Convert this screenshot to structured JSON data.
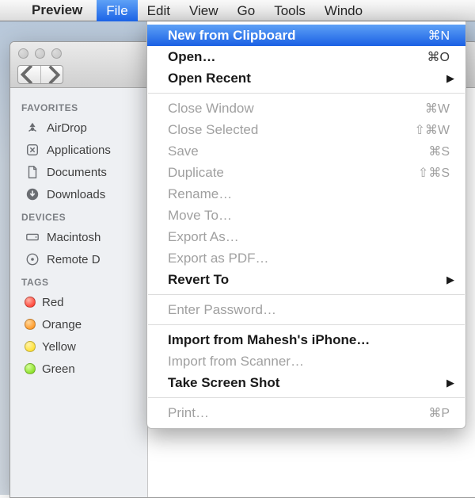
{
  "menubar": {
    "app_name": "Preview",
    "items": [
      "File",
      "Edit",
      "View",
      "Go",
      "Tools",
      "Windo"
    ]
  },
  "file_menu": {
    "groups": [
      [
        {
          "label": "New from Clipboard",
          "shortcut": "⌘N",
          "selected": true,
          "bold": true
        },
        {
          "label": "Open…",
          "shortcut": "⌘O",
          "bold": true
        },
        {
          "label": "Open Recent",
          "submenu": true,
          "bold": true
        }
      ],
      [
        {
          "label": "Close Window",
          "shortcut": "⌘W",
          "disabled": true
        },
        {
          "label": "Close Selected",
          "shortcut": "⇧⌘W",
          "disabled": true
        },
        {
          "label": "Save",
          "shortcut": "⌘S",
          "disabled": true
        },
        {
          "label": "Duplicate",
          "shortcut": "⇧⌘S",
          "disabled": true
        },
        {
          "label": "Rename…",
          "disabled": true
        },
        {
          "label": "Move To…",
          "disabled": true
        },
        {
          "label": "Export As…",
          "disabled": true
        },
        {
          "label": "Export as PDF…",
          "disabled": true
        },
        {
          "label": "Revert To",
          "submenu": true,
          "bold": true
        }
      ],
      [
        {
          "label": "Enter Password…",
          "disabled": true
        }
      ],
      [
        {
          "label": "Import from Mahesh's iPhone…",
          "bold": true
        },
        {
          "label": "Import from Scanner…",
          "disabled": true
        },
        {
          "label": "Take Screen Shot",
          "submenu": true,
          "bold": true
        }
      ],
      [
        {
          "label": "Print…",
          "shortcut": "⌘P",
          "disabled": true
        }
      ]
    ]
  },
  "sidebar": {
    "sections": [
      {
        "header": "FAVORITES",
        "items": [
          {
            "label": "AirDrop",
            "icon": "airdrop"
          },
          {
            "label": "Applications",
            "icon": "applications"
          },
          {
            "label": "Documents",
            "icon": "documents"
          },
          {
            "label": "Downloads",
            "icon": "downloads"
          }
        ]
      },
      {
        "header": "DEVICES",
        "items": [
          {
            "label": "Macintosh",
            "icon": "hdd"
          },
          {
            "label": "Remote D",
            "icon": "disc"
          }
        ]
      },
      {
        "header": "TAGS",
        "items": [
          {
            "label": "Red",
            "tag": "red"
          },
          {
            "label": "Orange",
            "tag": "orange"
          },
          {
            "label": "Yellow",
            "tag": "yellow"
          },
          {
            "label": "Green",
            "tag": "green"
          }
        ]
      }
    ]
  }
}
